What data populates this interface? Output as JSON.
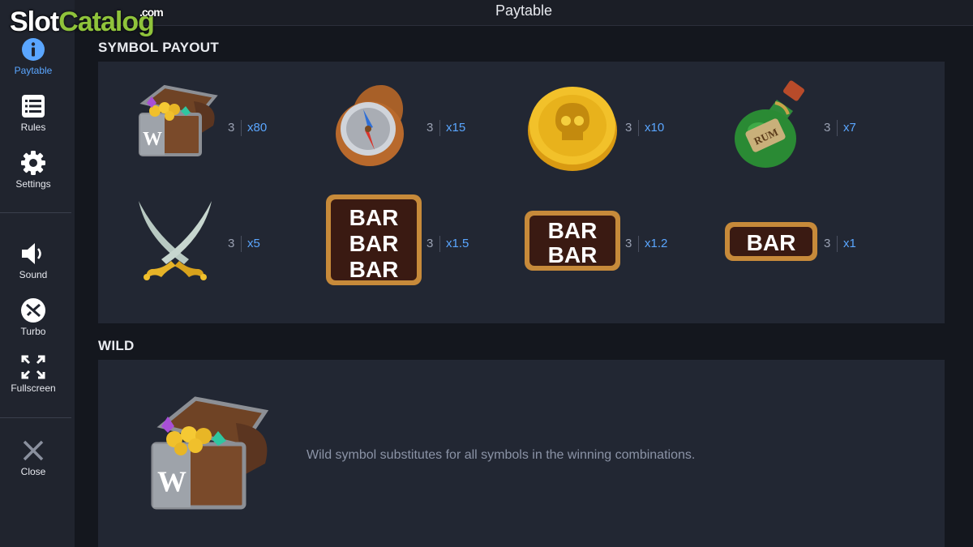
{
  "logo": {
    "slot": "Slot",
    "catalog": "Catalog",
    "com": ".com"
  },
  "header": {
    "title": "Paytable"
  },
  "sidebar": {
    "items": [
      {
        "label": "Paytable",
        "icon": "info-icon",
        "active": true
      },
      {
        "label": "Rules",
        "icon": "list-icon"
      },
      {
        "label": "Settings",
        "icon": "gear-icon"
      },
      {
        "label": "Sound",
        "icon": "speaker-icon"
      },
      {
        "label": "Turbo",
        "icon": "turbo-icon"
      },
      {
        "label": "Fullscreen",
        "icon": "fullscreen-icon"
      },
      {
        "label": "Close",
        "icon": "close-icon"
      }
    ]
  },
  "symbol_payout": {
    "title": "SYMBOL PAYOUT",
    "symbols": [
      {
        "name": "treasure-chest",
        "count": "3",
        "payout": "x80"
      },
      {
        "name": "compass",
        "count": "3",
        "payout": "x15"
      },
      {
        "name": "skull-coin",
        "count": "3",
        "payout": "x10"
      },
      {
        "name": "rum-bottle",
        "count": "3",
        "payout": "x7"
      },
      {
        "name": "crossed-sabres",
        "count": "3",
        "payout": "x5"
      },
      {
        "name": "triple-bar",
        "count": "3",
        "payout": "x1.5",
        "bar_text": "BAR"
      },
      {
        "name": "double-bar",
        "count": "3",
        "payout": "x1.2",
        "bar_text": "BAR"
      },
      {
        "name": "single-bar",
        "count": "3",
        "payout": "x1",
        "bar_text": "BAR"
      }
    ]
  },
  "wild": {
    "title": "WILD",
    "chest_letter": "W",
    "description": "Wild symbol substitutes for all symbols in the winning combinations."
  },
  "bottle_label": "RUM",
  "colors": {
    "accent": "#5aa6ff",
    "panel": "#222733",
    "sidebar": "#20242e",
    "logo_green": "#8fc33b"
  }
}
